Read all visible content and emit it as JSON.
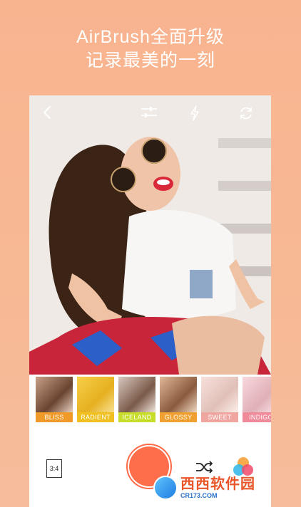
{
  "promo": {
    "line1": "AirBrush全面升级",
    "line2": "记录最美的一刻"
  },
  "toolbar": {
    "icons": [
      "back-icon",
      "adjust-sliders-icon",
      "flash-icon",
      "switch-camera-icon"
    ]
  },
  "filters": [
    {
      "label": "BLISS",
      "color": "#f09a2a"
    },
    {
      "label": "RADIENT",
      "color": "#f0c020"
    },
    {
      "label": "ICELAND",
      "color": "#c8dc2a"
    },
    {
      "label": "GLOSSY",
      "color": "#f0a030"
    },
    {
      "label": "SWEET",
      "color": "#f0a6a0"
    },
    {
      "label": "INDIGO",
      "color": "#f08a9a"
    }
  ],
  "bottom": {
    "ratio_label": "3:4",
    "shutter_color": "#ff6e4a"
  },
  "watermark": {
    "name": "西西软件园",
    "url": "CR173.COM"
  }
}
